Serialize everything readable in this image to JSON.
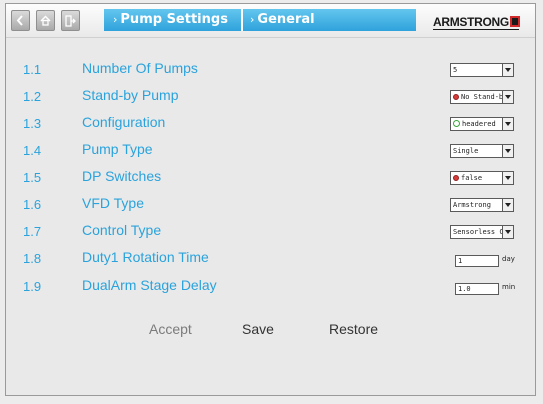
{
  "header": {
    "breadcrumb": [
      "Pump Settings",
      "General"
    ],
    "logo_text": "ARMSTRONG",
    "icons": [
      "back-icon",
      "home-icon",
      "exit-icon"
    ]
  },
  "settings": [
    {
      "num": "1.1",
      "label": "Number Of Pumps",
      "value": "5",
      "control": "select"
    },
    {
      "num": "1.2",
      "label": "Stand-by Pump",
      "value": "No Stand-by",
      "control": "select"
    },
    {
      "num": "1.3",
      "label": "Configuration",
      "value": "headered",
      "control": "select"
    },
    {
      "num": "1.4",
      "label": "Pump Type",
      "value": "Single",
      "control": "select"
    },
    {
      "num": "1.5",
      "label": "DP Switches",
      "value": "false",
      "control": "select"
    },
    {
      "num": "1.6",
      "label": "VFD Type",
      "value": "Armstrong",
      "control": "select"
    },
    {
      "num": "1.7",
      "label": "Control Type",
      "value": "Sensorless Con",
      "control": "select"
    },
    {
      "num": "1.8",
      "label": "Duty1 Rotation Time",
      "value": "1",
      "unit": "day",
      "control": "text"
    },
    {
      "num": "1.9",
      "label": "DualArm Stage Delay",
      "value": "1.0",
      "unit": "min",
      "control": "text"
    }
  ],
  "actions": {
    "accept": "Accept",
    "save": "Save",
    "restore": "Restore"
  },
  "colors": {
    "accent": "#2aa3dc",
    "breadcrumb_bg": "#3aaae0",
    "logo_red": "#d22a2a"
  }
}
